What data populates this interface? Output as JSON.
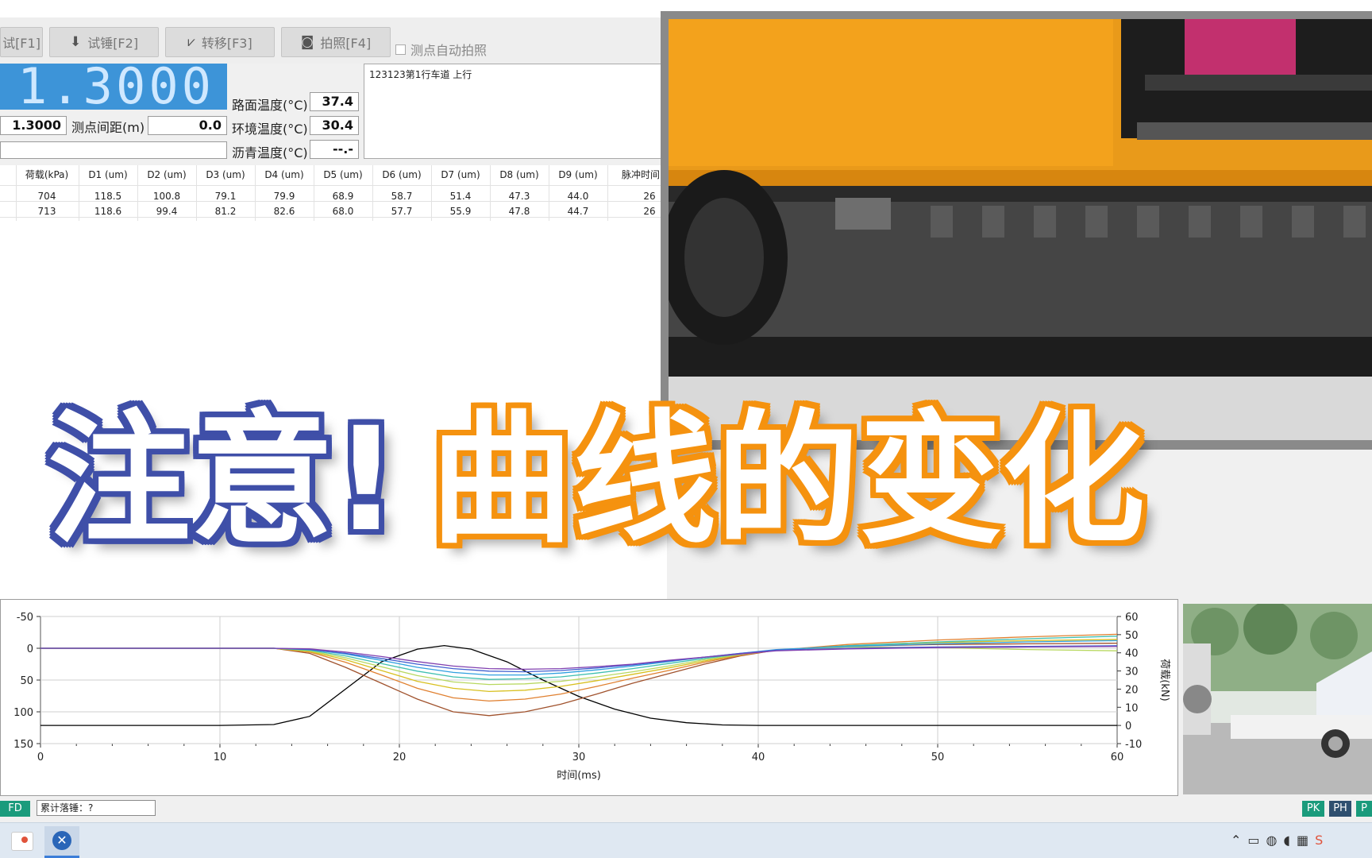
{
  "toolbar": {
    "buttons": [
      {
        "label": "试[F1]",
        "icon": "run-icon"
      },
      {
        "label": "试锤[F2]",
        "icon": "down-arrow-icon"
      },
      {
        "label": "转移[F3]",
        "icon": "transfer-icon"
      },
      {
        "label": "拍照[F4]",
        "icon": "camera-icon"
      }
    ],
    "auto_photo_label": "测点自动拍照"
  },
  "readouts": {
    "big_value": "1.3000",
    "station_value": "1.3000",
    "spacing_label": "测点间距(m)",
    "spacing_value": "0.0",
    "road_temp_label": "路面温度(°C)",
    "road_temp_value": "37.4",
    "env_temp_label": "环境温度(°C)",
    "env_temp_value": "30.4",
    "asphalt_temp_label": "沥青温度(°C)",
    "asphalt_temp_value": "--.-"
  },
  "notes": "123123第1行车道 上行",
  "table": {
    "headers": [
      ")",
      "荷载(kPa)",
      "D1 (um)",
      "D2 (um)",
      "D3 (um)",
      "D4 (um)",
      "D5 (um)",
      "D6 (um)",
      "D7 (um)",
      "D8 (um)",
      "D9 (um)",
      "脉冲时间"
    ],
    "rows": [
      [
        "",
        "704",
        "118.5",
        "100.8",
        "79.1",
        "79.9",
        "68.9",
        "58.7",
        "51.4",
        "47.3",
        "44.0",
        "26"
      ],
      [
        "",
        "713",
        "118.6",
        "99.4",
        "81.2",
        "82.6",
        "68.0",
        "57.7",
        "55.9",
        "47.8",
        "44.7",
        "26"
      ]
    ]
  },
  "headline": {
    "part1": "注意!",
    "part2": "曲线的变化",
    "color1": "#3f4fa8",
    "color2": "#f5920f"
  },
  "chart_data": {
    "type": "line",
    "xlabel": "时间(ms)",
    "ylabel_right": "荷载(kN)",
    "xlim": [
      0,
      60
    ],
    "ylim_left": [
      150,
      -50
    ],
    "ylim_right": [
      -10,
      60
    ],
    "x_ticks": [
      "0",
      "10",
      "20",
      "30",
      "40",
      "50",
      "60"
    ],
    "y_left_ticks": [
      "-50",
      "0",
      "50",
      "100",
      "150"
    ],
    "y_right_ticks": [
      "60",
      "50",
      "40",
      "30",
      "20",
      "10",
      "0",
      "-10"
    ],
    "grid": true,
    "series": [
      {
        "color": "#000000",
        "axis": "right",
        "x": [
          0,
          10,
          13,
          15,
          17,
          19,
          21,
          22.5,
          24,
          26,
          28,
          30,
          32,
          34,
          36,
          38,
          40,
          60
        ],
        "values": [
          0,
          0,
          0.5,
          5,
          20,
          35,
          42,
          44,
          42,
          35,
          25,
          16,
          9,
          4,
          1.5,
          0.3,
          0,
          0
        ]
      },
      {
        "color": "#a0522d",
        "axis": "left",
        "x": [
          0,
          13,
          15,
          17,
          19,
          21,
          23,
          25,
          27,
          29,
          31,
          33,
          35,
          37,
          39,
          41,
          45,
          50,
          55,
          60
        ],
        "values": [
          0,
          0,
          8,
          30,
          55,
          80,
          100,
          106,
          100,
          88,
          72,
          55,
          40,
          25,
          12,
          3,
          -3,
          -6,
          -7,
          -8
        ]
      },
      {
        "color": "#e08030",
        "axis": "left",
        "x": [
          0,
          13,
          15,
          17,
          19,
          21,
          23,
          25,
          27,
          29,
          31,
          33,
          35,
          37,
          39,
          41,
          45,
          50,
          55,
          60
        ],
        "values": [
          0,
          0,
          6,
          22,
          42,
          63,
          78,
          83,
          80,
          72,
          60,
          47,
          35,
          22,
          11,
          3,
          -6,
          -13,
          -18,
          -22
        ]
      },
      {
        "color": "#d8c020",
        "axis": "left",
        "x": [
          0,
          13,
          15,
          17,
          19,
          21,
          23,
          25,
          27,
          29,
          31,
          33,
          35,
          37,
          39,
          41,
          45,
          50,
          55,
          60
        ],
        "values": [
          0,
          0,
          5,
          18,
          35,
          52,
          63,
          68,
          66,
          60,
          51,
          41,
          31,
          20,
          10,
          3,
          -4,
          -9,
          -12,
          -14
        ]
      },
      {
        "color": "#b8d860",
        "axis": "left",
        "x": [
          0,
          13,
          15,
          17,
          19,
          21,
          23,
          25,
          27,
          29,
          31,
          33,
          35,
          37,
          39,
          41,
          45,
          50,
          55,
          60
        ],
        "values": [
          0,
          0,
          4,
          15,
          29,
          43,
          53,
          57,
          56,
          52,
          45,
          37,
          28,
          18,
          10,
          3,
          -2,
          -1,
          2,
          4
        ]
      },
      {
        "color": "#40c0b0",
        "axis": "left",
        "x": [
          0,
          13,
          15,
          17,
          19,
          21,
          23,
          25,
          27,
          29,
          31,
          33,
          35,
          37,
          39,
          41,
          45,
          50,
          55,
          60
        ],
        "values": [
          0,
          0,
          3,
          12,
          24,
          36,
          45,
          49,
          48,
          45,
          39,
          32,
          24,
          16,
          9,
          3,
          -4,
          -10,
          -15,
          -19
        ]
      },
      {
        "color": "#30a0e0",
        "axis": "left",
        "x": [
          0,
          13,
          15,
          17,
          19,
          21,
          23,
          25,
          27,
          29,
          31,
          33,
          35,
          37,
          39,
          41,
          45,
          50,
          55,
          60
        ],
        "values": [
          0,
          0,
          2,
          9,
          19,
          30,
          38,
          42,
          42,
          39,
          34,
          28,
          21,
          14,
          8,
          2,
          -3,
          -7,
          -10,
          -12
        ]
      },
      {
        "color": "#4060d0",
        "axis": "left",
        "x": [
          0,
          13,
          15,
          17,
          19,
          21,
          23,
          25,
          27,
          29,
          31,
          33,
          35,
          37,
          39,
          41,
          45,
          50,
          55,
          60
        ],
        "values": [
          0,
          0,
          2,
          8,
          16,
          25,
          32,
          36,
          37,
          35,
          31,
          26,
          20,
          14,
          8,
          3,
          0,
          -2,
          -3,
          -4
        ]
      },
      {
        "color": "#8040b0",
        "axis": "left",
        "x": [
          0,
          13,
          15,
          17,
          19,
          21,
          23,
          25,
          27,
          29,
          31,
          33,
          35,
          37,
          39,
          41,
          45,
          50,
          55,
          60
        ],
        "values": [
          0,
          0,
          1,
          6,
          13,
          21,
          28,
          32,
          33,
          32,
          29,
          25,
          19,
          14,
          9,
          4,
          1,
          -1,
          -2,
          -3
        ]
      }
    ]
  },
  "status": {
    "left_badge": "FD",
    "drops_label": "累计落锤：?",
    "right_badges": [
      "PK",
      "PH",
      "P"
    ]
  },
  "colors": {
    "accent_blue": "#3d94d8",
    "badge_green": "#1a9b7c",
    "badge_navy": "#2f4f6f"
  }
}
